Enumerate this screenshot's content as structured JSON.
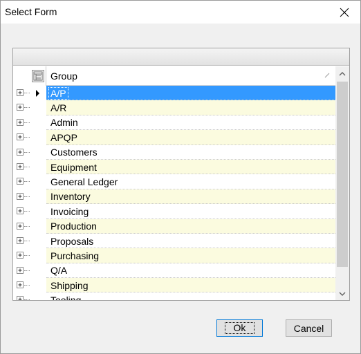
{
  "window": {
    "title": "Select Form",
    "close_icon": "close-icon"
  },
  "grid": {
    "column_header": "Group",
    "column_chooser_icon": "column-chooser-icon",
    "rows": [
      {
        "label": "A/P",
        "selected": true
      },
      {
        "label": "A/R"
      },
      {
        "label": "Admin"
      },
      {
        "label": "APQP"
      },
      {
        "label": "Customers"
      },
      {
        "label": "Equipment"
      },
      {
        "label": "General Ledger"
      },
      {
        "label": "Inventory"
      },
      {
        "label": "Invoicing"
      },
      {
        "label": "Production"
      },
      {
        "label": "Proposals"
      },
      {
        "label": "Purchasing"
      },
      {
        "label": "Q/A"
      },
      {
        "label": "Shipping"
      },
      {
        "label": "Tooling"
      }
    ]
  },
  "buttons": {
    "ok": "Ok",
    "cancel": "Cancel"
  },
  "colors": {
    "selection": "#3399ff",
    "alt_row": "#fbfbdf"
  }
}
